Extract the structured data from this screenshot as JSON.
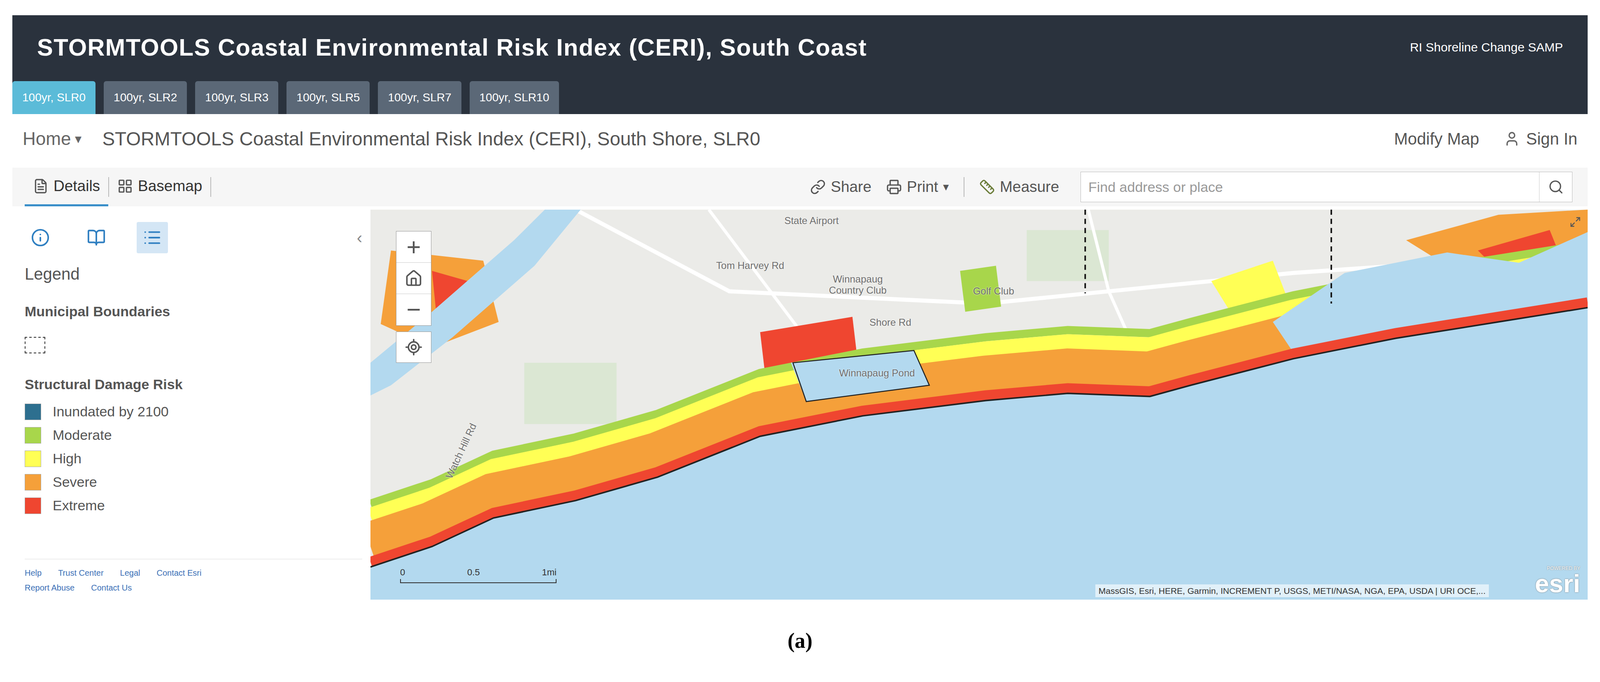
{
  "header": {
    "title": "STORMTOOLS Coastal Environmental Risk Index (CERI), South Coast",
    "link": "RI Shoreline Change SAMP"
  },
  "tabs": [
    {
      "label": "100yr, SLR0",
      "selected": true
    },
    {
      "label": "100yr, SLR2",
      "selected": false
    },
    {
      "label": "100yr, SLR3",
      "selected": false
    },
    {
      "label": "100yr, SLR5",
      "selected": false
    },
    {
      "label": "100yr, SLR7",
      "selected": false
    },
    {
      "label": "100yr, SLR10",
      "selected": false
    }
  ],
  "breadcrumb": {
    "home": "Home",
    "caret": "▾",
    "title": "STORMTOOLS Coastal Environmental Risk Index (CERI), South Shore, SLR0"
  },
  "account": {
    "modify": "Modify Map",
    "sign_in": "Sign In"
  },
  "toolbar": {
    "tabs": [
      {
        "label": "Details",
        "kind": "details",
        "selected": true
      },
      {
        "label": "Basemap",
        "kind": "basemap",
        "selected": false
      }
    ],
    "share": "Share",
    "print": "Print",
    "print_caret": "▾",
    "measure": "Measure"
  },
  "search": {
    "placeholder": "Find address or place"
  },
  "side_panel": {
    "views": [
      {
        "kind": "about",
        "selected": false
      },
      {
        "kind": "content",
        "selected": false
      },
      {
        "kind": "legend",
        "selected": true
      }
    ],
    "collapse": "‹",
    "legend_title": "Legend",
    "boundary_title": "Municipal Boundaries",
    "risk_title": "Structural Damage Risk",
    "risk_items": [
      {
        "label": "Inundated by 2100",
        "color": "#2d6f8f"
      },
      {
        "label": "Moderate",
        "color": "#a8d64b"
      },
      {
        "label": "High",
        "color": "#ffff55"
      },
      {
        "label": "Severe",
        "color": "#f5a03a"
      },
      {
        "label": "Extreme",
        "color": "#ef4630"
      }
    ],
    "footer_links": [
      [
        "Help",
        "Trust Center",
        "Legal",
        "Contact Esri"
      ],
      [
        "Report Abuse",
        "Contact Us"
      ]
    ]
  },
  "map": {
    "zoom_in": "+",
    "zoom_out": "−",
    "labels": [
      "State Airport",
      "Tom Harvey Rd",
      "Winnapaug Country Club",
      "Shore Rd",
      "Golf Club",
      "Winnapaug Pond",
      "Watch Hill Rd"
    ],
    "scale": [
      "0",
      "0.5",
      "1mi"
    ],
    "attribution": "MassGIS, Esri, HERE, Garmin, INCREMENT P, USGS, METI/NASA, NGA, EPA, USDA | URI OCE,...",
    "logo": {
      "powered": "POWERED BY",
      "name": "esri"
    }
  },
  "caption": "(a)"
}
